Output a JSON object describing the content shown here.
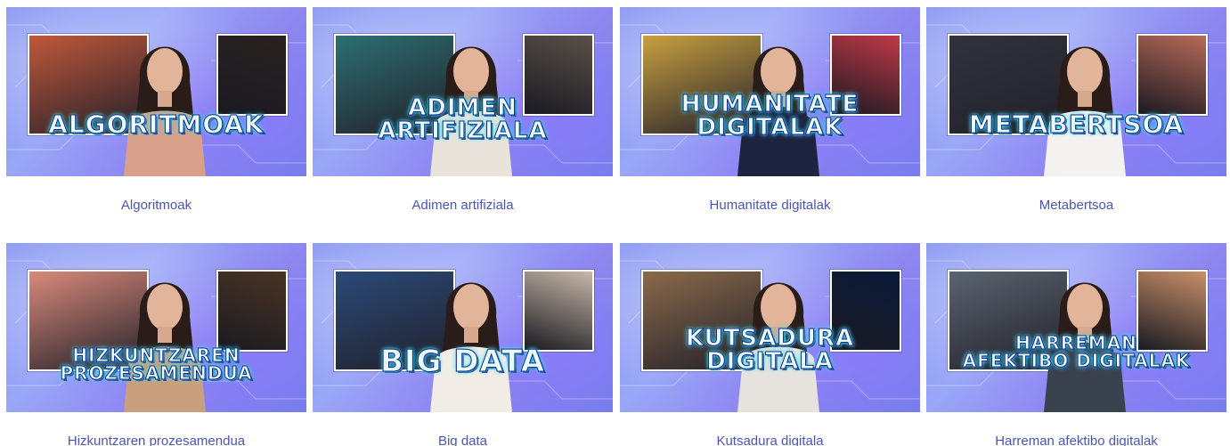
{
  "cards": [
    {
      "caption": "Algoritmoak",
      "overlay": "ALGORITMOAK",
      "left_bg": "#c0583a",
      "right_bg": "#2a2220",
      "shirt": "#d8a08a"
    },
    {
      "caption": "Adimen artifiziala",
      "overlay": "ADIMEN\nARTIFIZIALA",
      "left_bg": "#2c6f72",
      "right_bg": "#5a5048",
      "shirt": "#e8e4dc"
    },
    {
      "caption": "Humanitate digitalak",
      "overlay": "HUMANITATE\nDIGITALAK",
      "left_bg": "#c8a040",
      "right_bg": "#c03848",
      "shirt": "#1e2340"
    },
    {
      "caption": "Metabertsoa",
      "overlay": "METABERTSOA",
      "left_bg": "#30343c",
      "right_bg": "#b86a58",
      "shirt": "#f4f2f0"
    },
    {
      "caption": "Hizkuntzaren prozesamendua",
      "overlay": "HIZKUNTZAREN\nPROZESAMENDUA",
      "left_bg": "#d98a7a",
      "right_bg": "#4a3424",
      "shirt": "#c9a07e"
    },
    {
      "caption": "Big data",
      "overlay": "BIG DATA",
      "left_bg": "#2a4a78",
      "right_bg": "#c8b8a8",
      "shirt": "#f2ece6"
    },
    {
      "caption": "Kutsadura digitala",
      "overlay": "KUTSADURA\nDIGITALA",
      "left_bg": "#8a6a4a",
      "right_bg": "#0a1a3a",
      "shirt": "#e6e2de"
    },
    {
      "caption": "Harreman afektibo digitalak",
      "overlay": "HARREMAN\nAFEKTIBO DIGITALAK",
      "left_bg": "#5a6470",
      "right_bg": "#c89068",
      "shirt": "#3a4250"
    }
  ]
}
